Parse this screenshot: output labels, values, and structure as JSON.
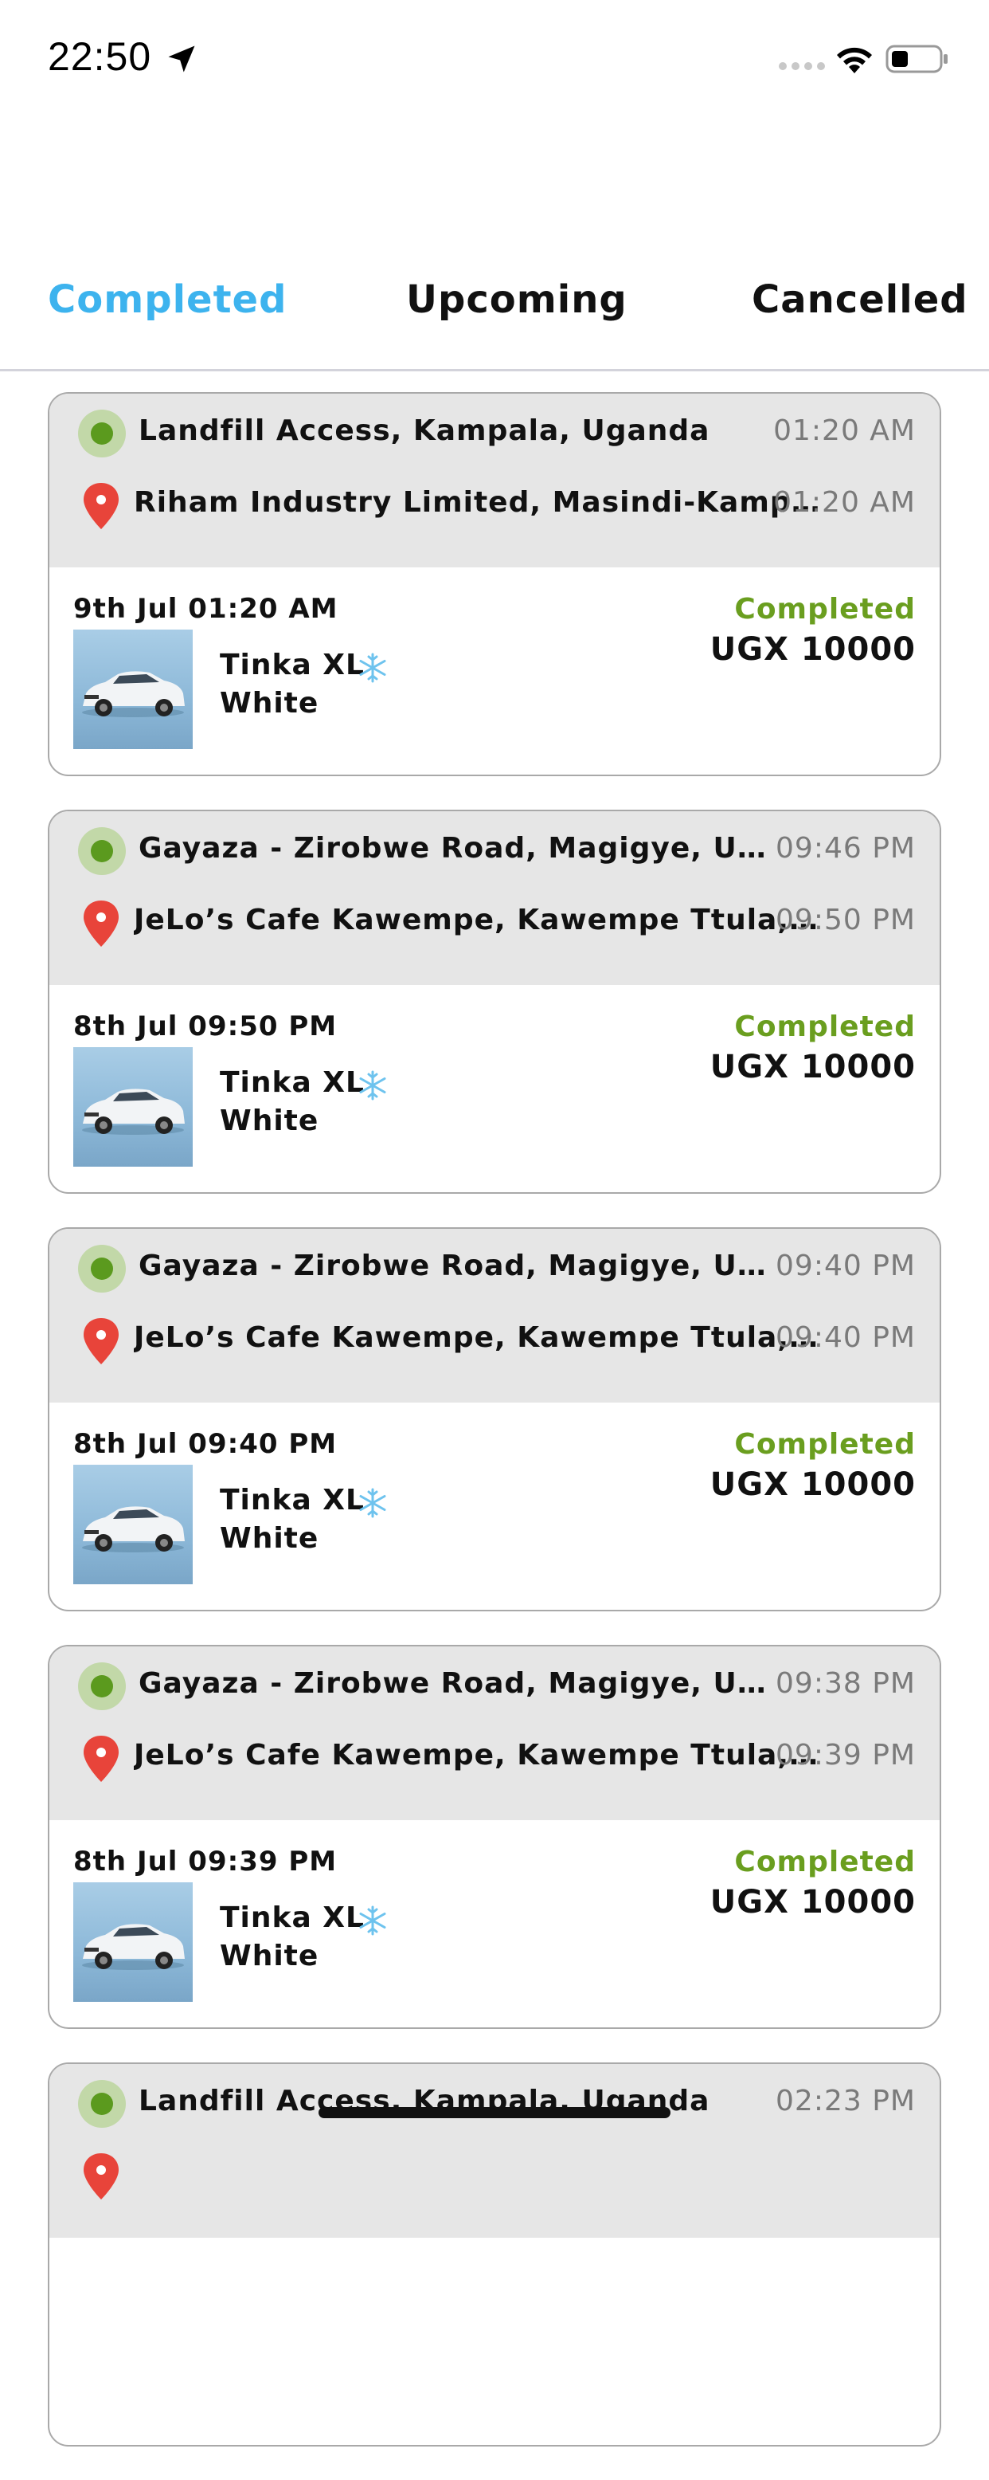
{
  "status_bar": {
    "time": "22:50",
    "location_icon": "location-arrow-icon",
    "signal_icon": "cellular-signal-icon",
    "wifi_icon": "wifi-icon",
    "battery_icon": "battery-icon"
  },
  "tabs": [
    {
      "label": "Completed",
      "active": true
    },
    {
      "label": "Upcoming",
      "active": false
    },
    {
      "label": "Cancelled",
      "active": false
    }
  ],
  "colors": {
    "active_tab": "#3db3ee",
    "status_completed": "#6a9e1f",
    "pickup_marker": "#5b9a1e",
    "dropoff_marker": "#e8443a",
    "card_header_bg": "#e6e6e6"
  },
  "rides": [
    {
      "pickup": "Landfill Access, Kampala, Uganda",
      "pickup_time": "01:20 AM",
      "dropoff": "Riham Industry Limited, Masindi-Kampala Road, Kampala, Uganda",
      "dropoff_time": "01:20 AM",
      "date": "9th Jul 01:20 AM",
      "car_model": "Tinka XL",
      "car_color": "White",
      "status": "Completed",
      "fare": "UGX 10000"
    },
    {
      "pickup": "Gayaza - Zirobwe Road, Magigye, Uganda",
      "pickup_time": "09:46 PM",
      "dropoff": "JeLo’s Cafe Kawempe, Kawempe Ttula, Kampala",
      "dropoff_time": "09:50 PM",
      "date": "8th Jul 09:50 PM",
      "car_model": "Tinka XL",
      "car_color": "White",
      "status": "Completed",
      "fare": "UGX 10000"
    },
    {
      "pickup": "Gayaza - Zirobwe Road, Magigye, Uganda",
      "pickup_time": "09:40 PM",
      "dropoff": "JeLo’s Cafe Kawempe, Kawempe Ttula, Kampala",
      "dropoff_time": "09:40 PM",
      "date": "8th Jul 09:40 PM",
      "car_model": "Tinka XL",
      "car_color": "White",
      "status": "Completed",
      "fare": "UGX 10000"
    },
    {
      "pickup": "Gayaza - Zirobwe Road, Magigye, Uganda",
      "pickup_time": "09:38 PM",
      "dropoff": "JeLo’s Cafe Kawempe, Kawempe Ttula, Kampala",
      "dropoff_time": "09:39 PM",
      "date": "8th Jul 09:39 PM",
      "car_model": "Tinka XL",
      "car_color": "White",
      "status": "Completed",
      "fare": "UGX 10000"
    },
    {
      "pickup": "Landfill Access, Kampala, Uganda",
      "pickup_time": "02:23 PM",
      "dropoff": "",
      "dropoff_time": "",
      "date": "",
      "car_model": "",
      "car_color": "",
      "status": "",
      "fare": ""
    }
  ]
}
